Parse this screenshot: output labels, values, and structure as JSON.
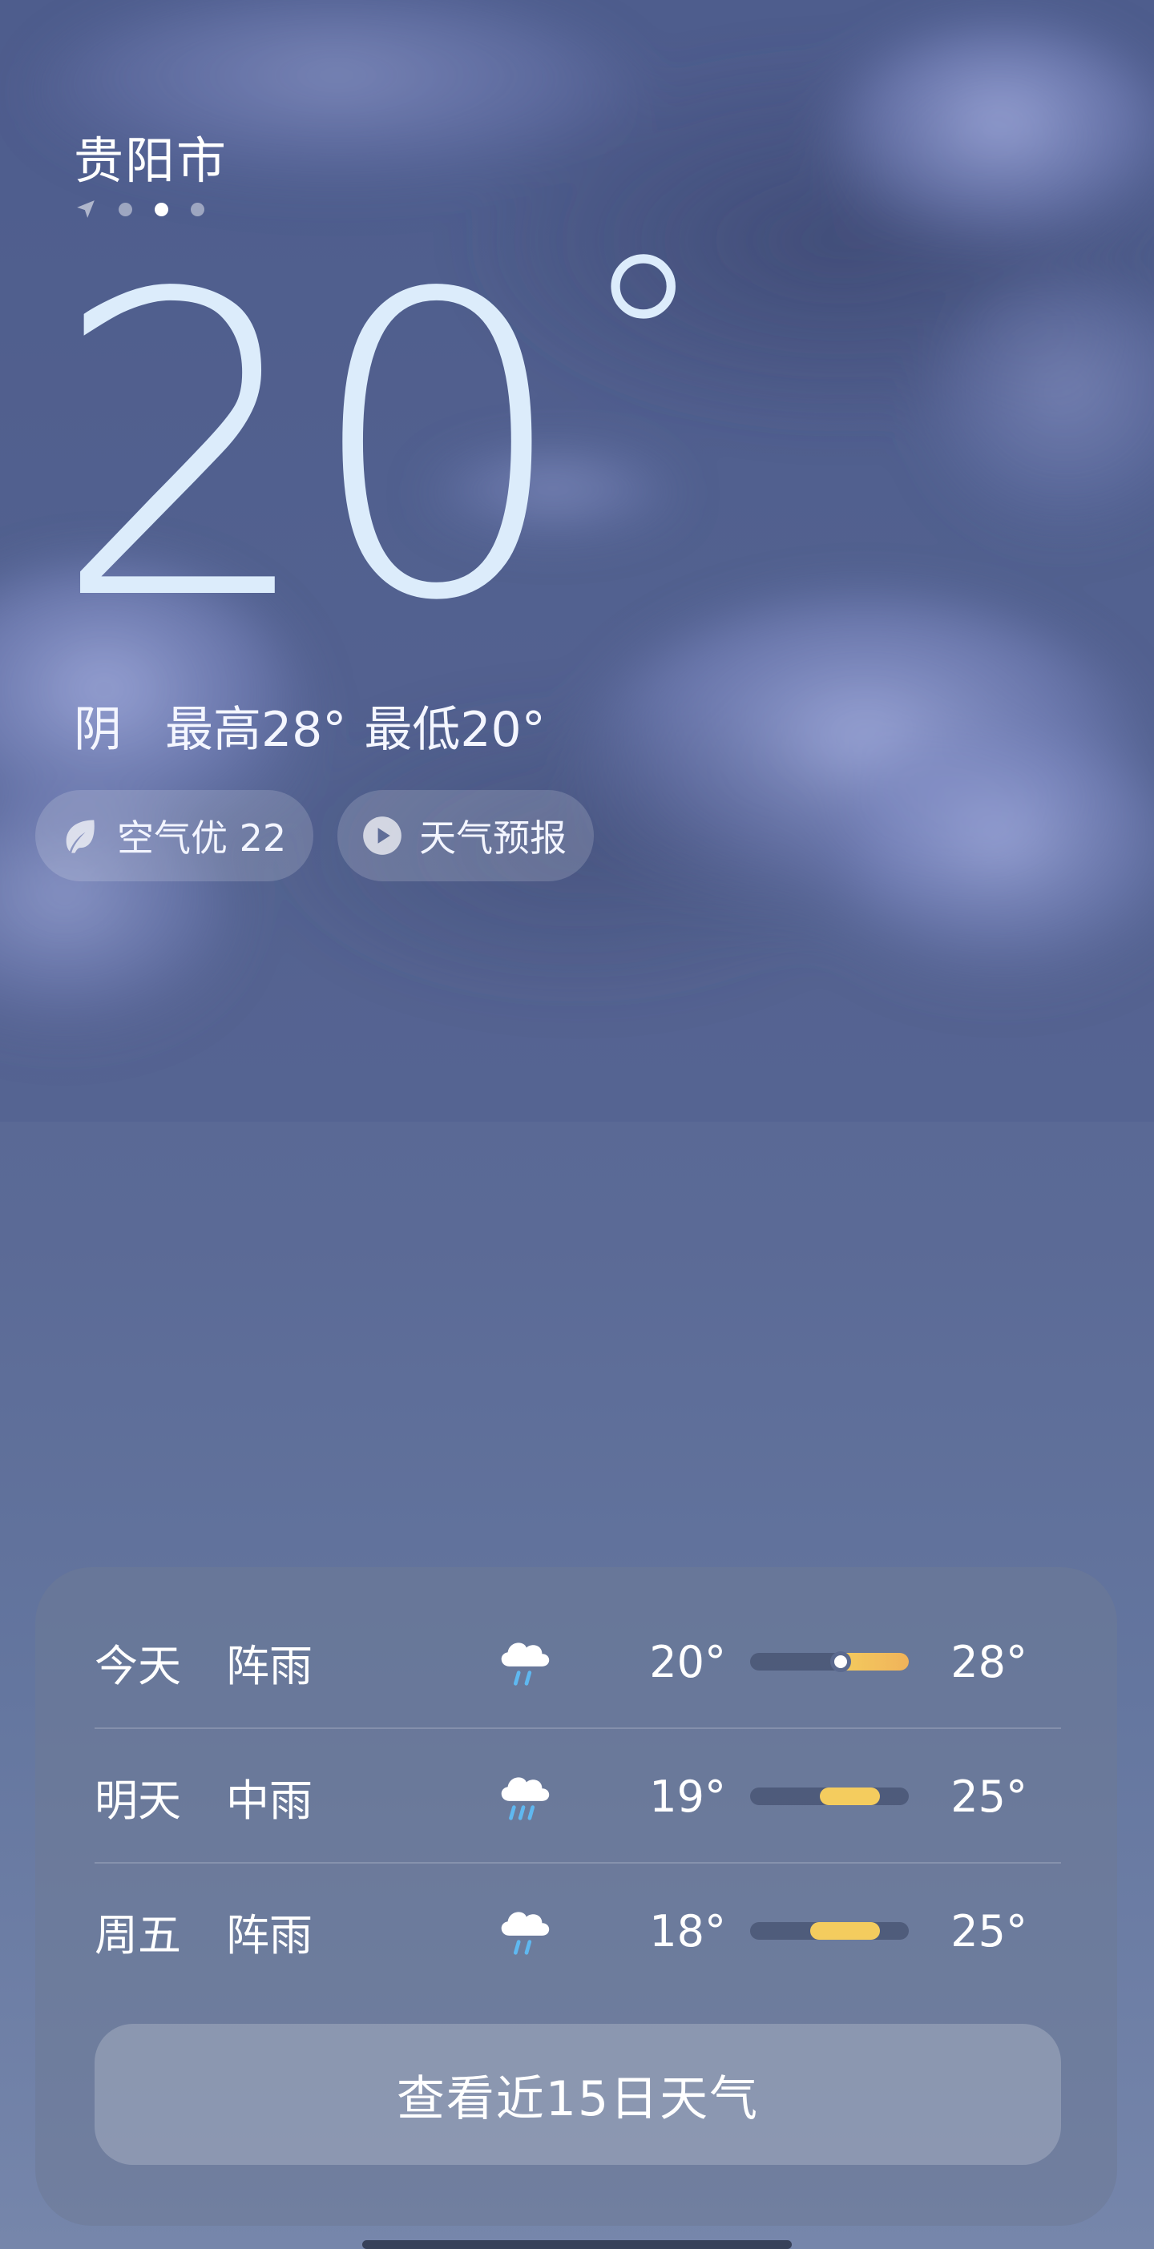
{
  "city": "贵阳市",
  "current": {
    "temp": "20",
    "degree_symbol": "°",
    "condition": "阴",
    "high": "最高28°",
    "low": "最低20°"
  },
  "chips": {
    "air_quality": "空气优 22",
    "forecast_video": "天气预报"
  },
  "forecast": [
    {
      "day": "今天",
      "condition": "阵雨",
      "icon": "shower-rain-icon",
      "low": "20°",
      "high": "28°",
      "range_fraction": [
        0.55,
        1.0
      ],
      "current_marker": 0.57
    },
    {
      "day": "明天",
      "condition": "中雨",
      "icon": "moderate-rain-icon",
      "low": "19°",
      "high": "25°",
      "range_fraction": [
        0.44,
        0.82
      ]
    },
    {
      "day": "周五",
      "condition": "阵雨",
      "icon": "shower-rain-icon",
      "low": "18°",
      "high": "25°",
      "range_fraction": [
        0.38,
        0.82
      ]
    }
  ],
  "more_button": "查看近15日天气",
  "colors": {
    "bar_warm": "#f0b35a",
    "bar_yellow": "#f4cc5e",
    "temp_text": "#dcecfb"
  }
}
